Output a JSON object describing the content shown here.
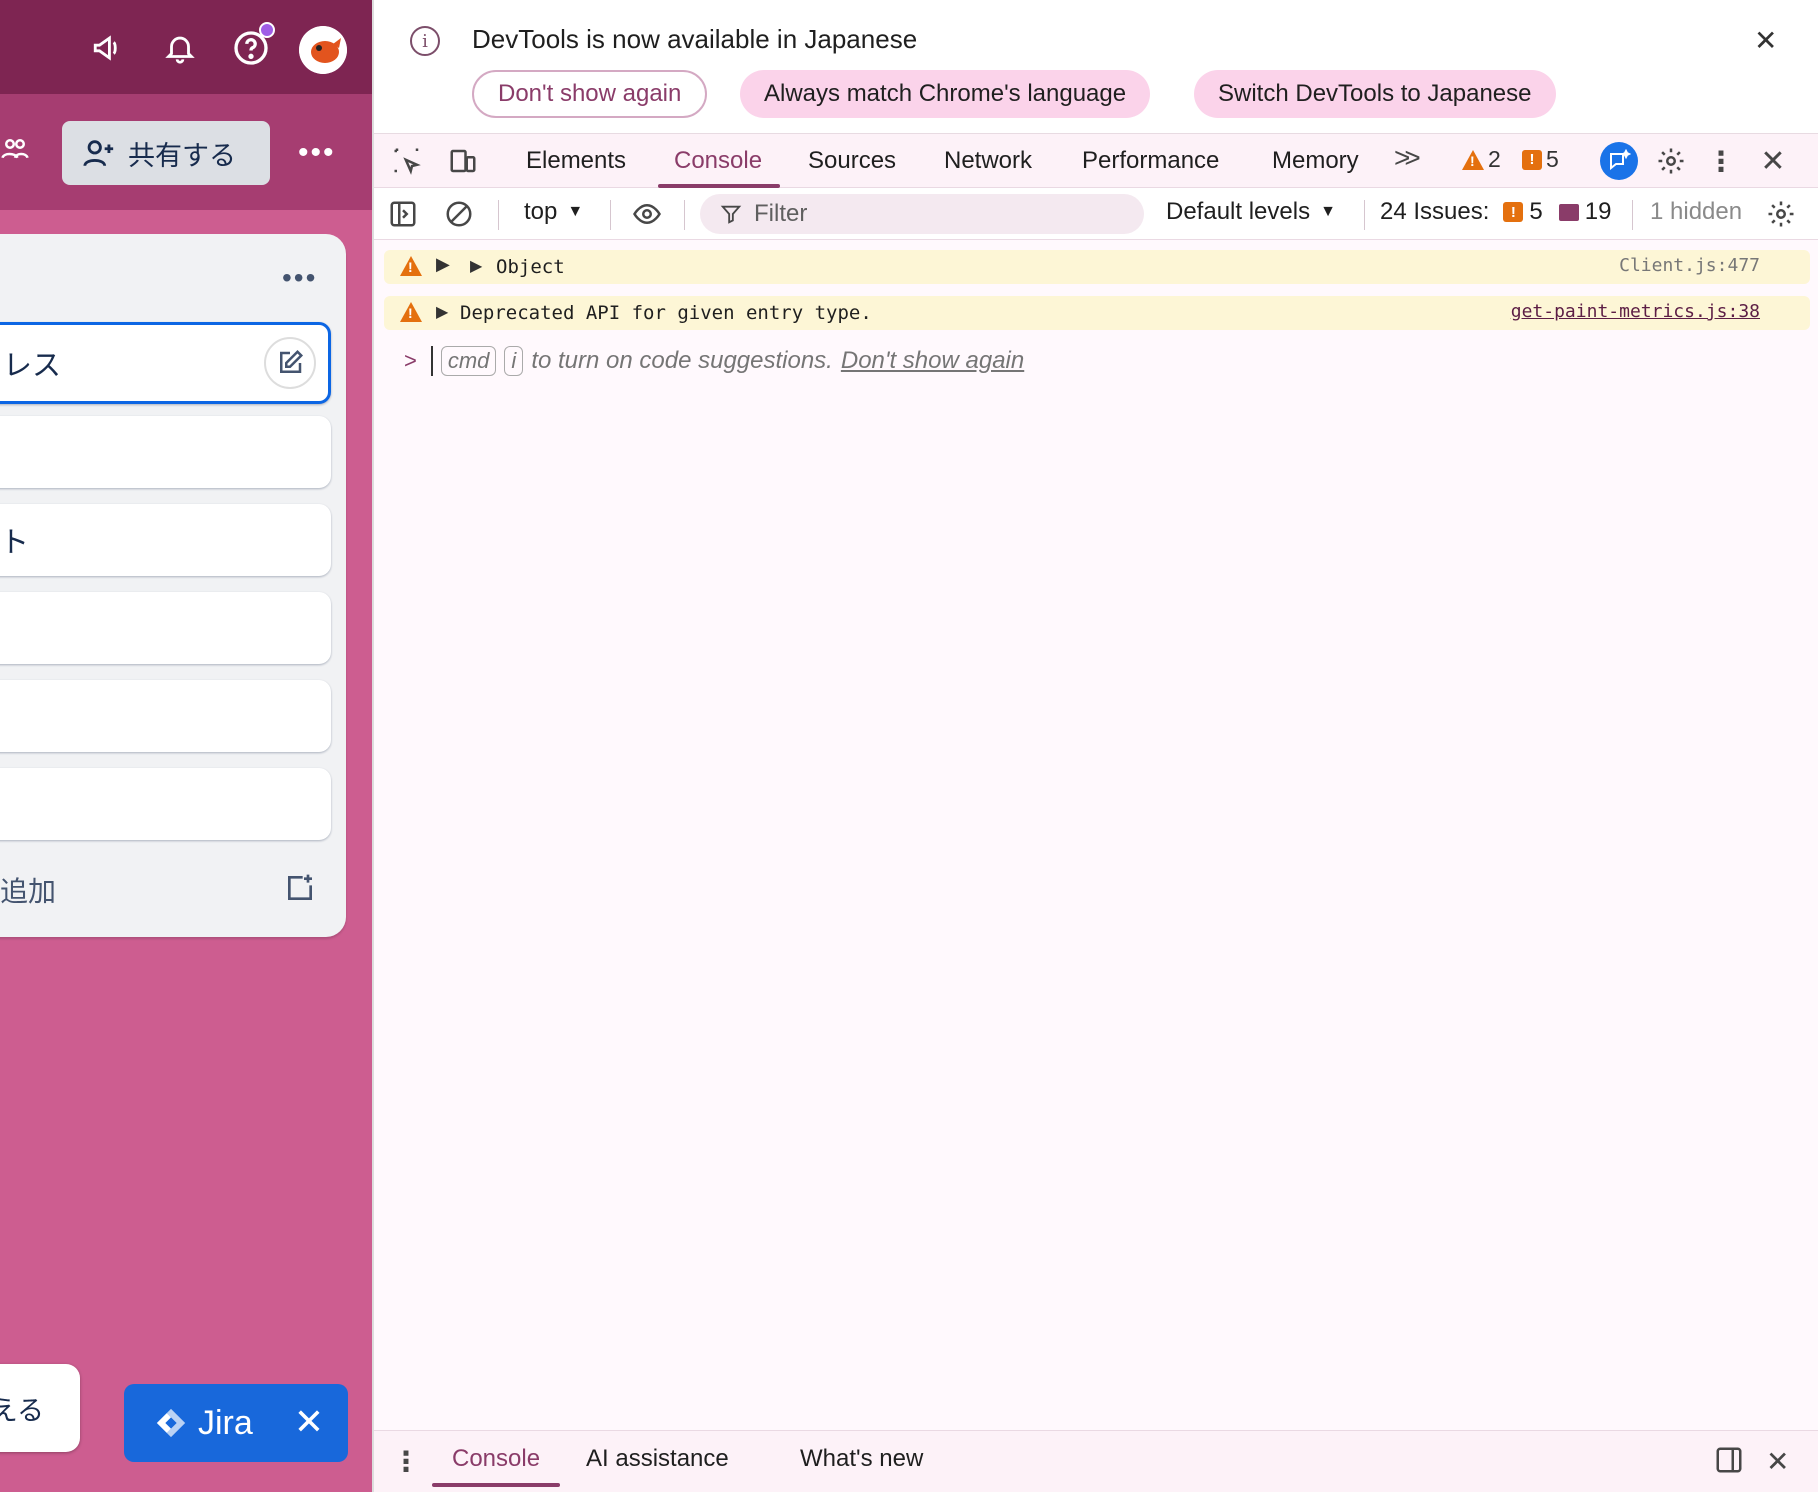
{
  "left": {
    "share_label": "共有する",
    "cards": [
      "レス",
      "",
      "ト",
      "",
      "",
      ""
    ],
    "add_card_label": "追加",
    "bottom_button_label": "える",
    "jira_label": "Jira",
    "jira_close": "✕"
  },
  "infobar": {
    "message": "DevTools is now available in Japanese",
    "close": "✕",
    "buttons": [
      "Don't show again",
      "Always match Chrome's language",
      "Switch DevTools to Japanese"
    ]
  },
  "tabs": {
    "items": [
      "Elements",
      "Console",
      "Sources",
      "Network",
      "Performance",
      "Memory"
    ],
    "selected": "Console",
    "warning_count": "2",
    "error_count": "5"
  },
  "toolbar": {
    "context": "top",
    "filter_placeholder": "Filter",
    "levels": "Default levels",
    "issues_label": "24 Issues:",
    "issues_errors": "5",
    "issues_messages": "19",
    "hidden": "1 hidden"
  },
  "console": {
    "messages": [
      {
        "text": "Object",
        "source": "Client.js:477",
        "level": "warning"
      },
      {
        "text": "Deprecated API for given entry type.",
        "source": "get-paint-metrics.js:38",
        "level": "warning"
      }
    ],
    "prompt_key1": "cmd",
    "prompt_key2": "i",
    "prompt_text": "to turn on code suggestions.",
    "prompt_link": "Don't show again"
  },
  "drawer": {
    "tabs": [
      "Console",
      "AI assistance",
      "What's new"
    ]
  },
  "colors": {
    "accent": "#8a3c69",
    "warning": "#e4700e",
    "board_bg": "#cd5d90",
    "topbar_bg": "#7e2552",
    "jira_blue": "#1868db"
  }
}
